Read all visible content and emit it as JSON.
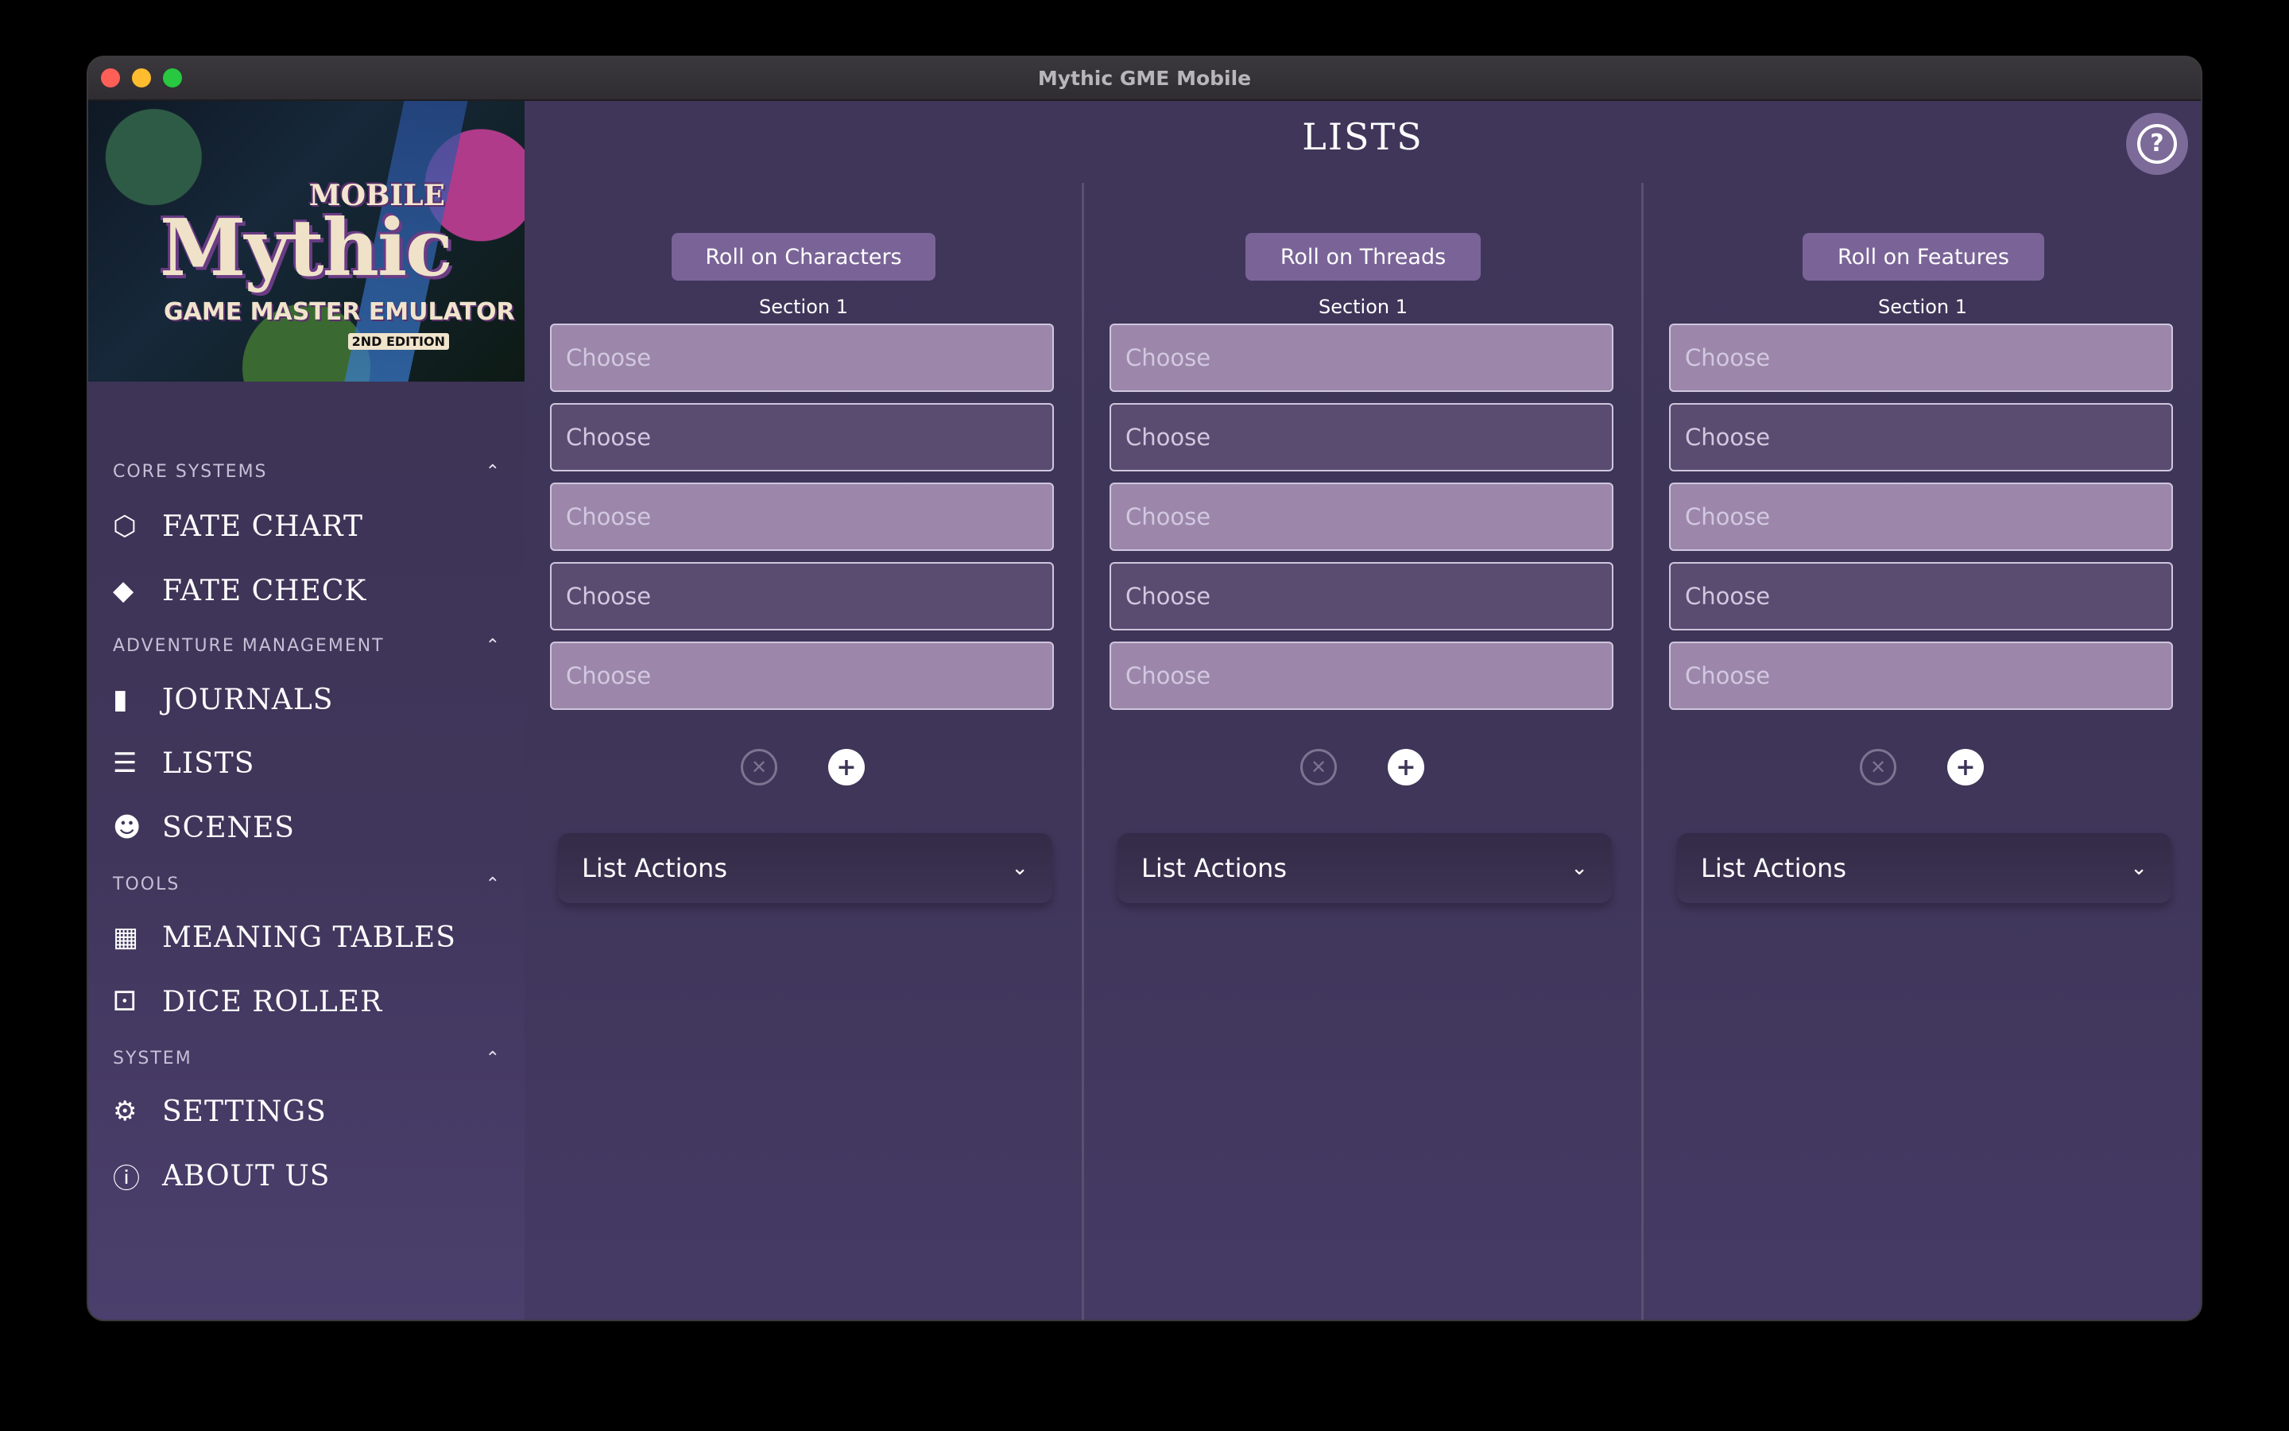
{
  "window": {
    "title": "Mythic GME Mobile"
  },
  "logo": {
    "line1": "MOBILE",
    "line2": "Mythic",
    "line3": "GAME MASTER EMULATOR",
    "line4": "2ND EDITION"
  },
  "sidebar": {
    "sections": [
      {
        "label": "CORE SYSTEMS",
        "items": [
          {
            "label": "FATE CHART",
            "icon": "d20-icon"
          },
          {
            "label": "FATE CHECK",
            "icon": "d10-icon"
          }
        ]
      },
      {
        "label": "ADVENTURE MANAGEMENT",
        "items": [
          {
            "label": "JOURNALS",
            "icon": "book-icon"
          },
          {
            "label": "LISTS",
            "icon": "list-icon"
          },
          {
            "label": "SCENES",
            "icon": "masks-icon"
          }
        ]
      },
      {
        "label": "TOOLS",
        "items": [
          {
            "label": "MEANING TABLES",
            "icon": "table-icon"
          },
          {
            "label": "DICE ROLLER",
            "icon": "dice-icon"
          }
        ]
      },
      {
        "label": "SYSTEM",
        "items": [
          {
            "label": "SETTINGS",
            "icon": "gear-icon"
          },
          {
            "label": "ABOUT US",
            "icon": "info-icon"
          }
        ]
      }
    ]
  },
  "main": {
    "title": "LISTS",
    "columns": [
      {
        "roll_label": "Roll on Characters",
        "section_label": "Section 1",
        "entries": [
          "Choose",
          "Choose",
          "Choose",
          "Choose",
          "Choose"
        ],
        "actions_label": "List Actions"
      },
      {
        "roll_label": "Roll on Threads",
        "section_label": "Section 1",
        "entries": [
          "Choose",
          "Choose",
          "Choose",
          "Choose",
          "Choose"
        ],
        "actions_label": "List Actions"
      },
      {
        "roll_label": "Roll on Features",
        "section_label": "Section 1",
        "entries": [
          "Choose",
          "Choose",
          "Choose",
          "Choose",
          "Choose"
        ],
        "actions_label": "List Actions"
      }
    ]
  },
  "colors": {
    "accent": "#7a6497",
    "background": "#3e3557",
    "entry_light": "#9c87aa",
    "entry_dark": "#5a4c70"
  }
}
